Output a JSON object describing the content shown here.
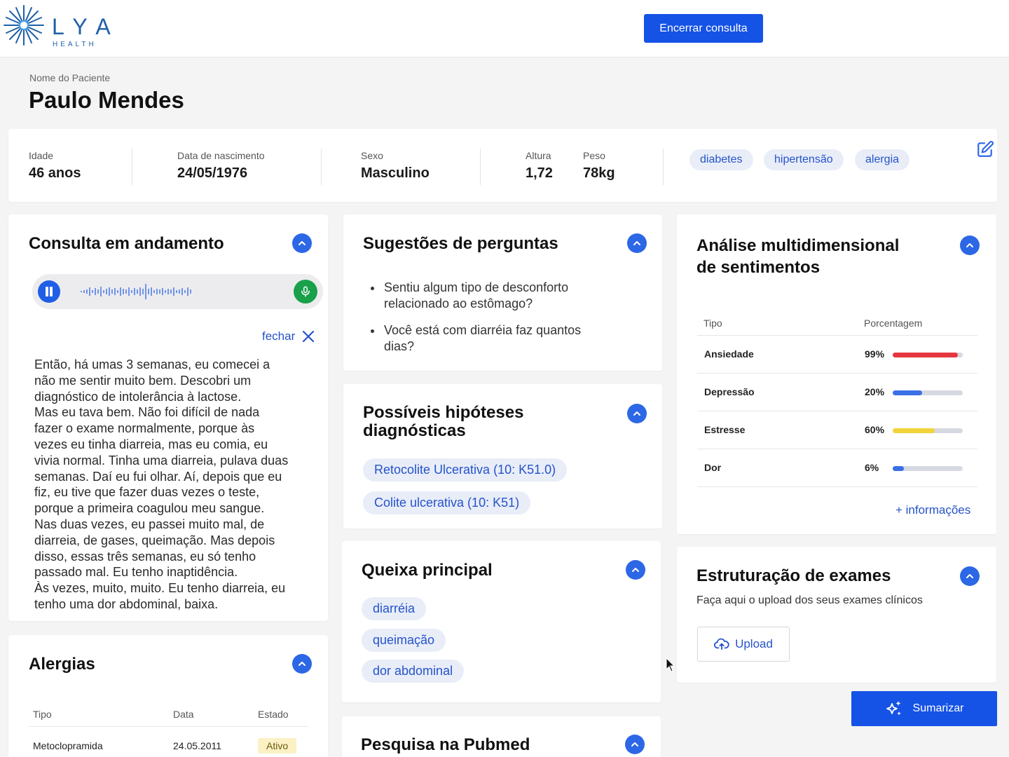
{
  "brand": {
    "name": "LYA",
    "sub": "HEALTH"
  },
  "header": {
    "end_button": "Encerrar consulta"
  },
  "patient": {
    "label": "Nome do Paciente",
    "name": "Paulo Mendes",
    "fields": [
      {
        "label": "Idade",
        "value": "46 anos"
      },
      {
        "label": "Data de nascimento",
        "value": "24/05/1976"
      },
      {
        "label": "Sexo",
        "value": "Masculino"
      },
      {
        "label": "Altura",
        "value": "1,72"
      },
      {
        "label": "Peso",
        "value": "78kg"
      }
    ],
    "tags": [
      "diabetes",
      "hipertensão",
      "alergia"
    ],
    "edit_icon": "pencil-square-icon"
  },
  "consultation": {
    "title": "Consulta em andamento",
    "close_label": "fechar",
    "transcript": "Então, há umas 3 semanas, eu comecei a\nnão me sentir muito bem. Descobri um\ndiagnóstico de intolerância à lactose.\nMas eu tava bem. Não foi difícil de nada\nfazer o exame normalmente, porque às\nvezes eu tinha diarreia, mas eu comia, eu\nvivia normal. Tinha uma diarreia, pulava duas\nsemanas. Daí eu fui olhar. Aí, depois que eu\nfiz, eu tive que fazer duas vezes o teste,\nporque a primeira coagulou meu sangue.\nNas duas vezes, eu passei muito mal, de\ndiarreia, de gases, queimação. Mas depois\ndisso, essas três semanas, eu só tenho\npassado mal. Eu tenho inaptidência.\nÀs vezes, muito, muito. Eu tenho diarreia, eu\ntenho uma dor abdominal, baixa."
  },
  "suggestions": {
    "title": "Sugestões de perguntas",
    "items": [
      "Sentiu algum tipo de desconforto relacionado ao estômago?",
      "Você está com diarréia faz quantos dias?"
    ]
  },
  "hypotheses": {
    "title_line1": "Possíveis hipóteses",
    "title_line2": "diagnósticas",
    "items": [
      "Retocolite Ulcerativa (10: K51.0)",
      "Colite ulcerativa (10: K51)"
    ]
  },
  "complaint": {
    "title": "Queixa principal",
    "items": [
      "diarréia",
      "queimação",
      "dor abdominal"
    ]
  },
  "pubmed": {
    "title": "Pesquisa na Pubmed"
  },
  "sentiment": {
    "title_line1": "Análise multidimensional",
    "title_line2": "de sentimentos",
    "col_type": "Tipo",
    "col_pct": "Porcentagem",
    "rows": [
      {
        "type": "Ansiedade",
        "pct_label": "99%",
        "value": 0.93,
        "color": "#e5373f"
      },
      {
        "type": "Depressão",
        "pct_label": "20%",
        "value": 0.42,
        "color": "#3b6fe6"
      },
      {
        "type": "Estresse",
        "pct_label": "60%",
        "value": 0.6,
        "color": "#f3d33a"
      },
      {
        "type": "Dor",
        "pct_label": "6%",
        "value": 0.16,
        "color": "#3b6fe6"
      }
    ],
    "more": "+ informações"
  },
  "exams": {
    "title": "Estruturação de exames",
    "subtitle": "Faça aqui o upload dos seus exames clínicos",
    "upload_label": "Upload"
  },
  "allergies": {
    "title": "Alergias",
    "headers": [
      "Tipo",
      "Data",
      "Estado"
    ],
    "rows": [
      {
        "type": "Metoclopramida",
        "date": "24.05.2011",
        "status": "Ativo"
      }
    ]
  },
  "summarize": {
    "label": "Sumarizar"
  }
}
